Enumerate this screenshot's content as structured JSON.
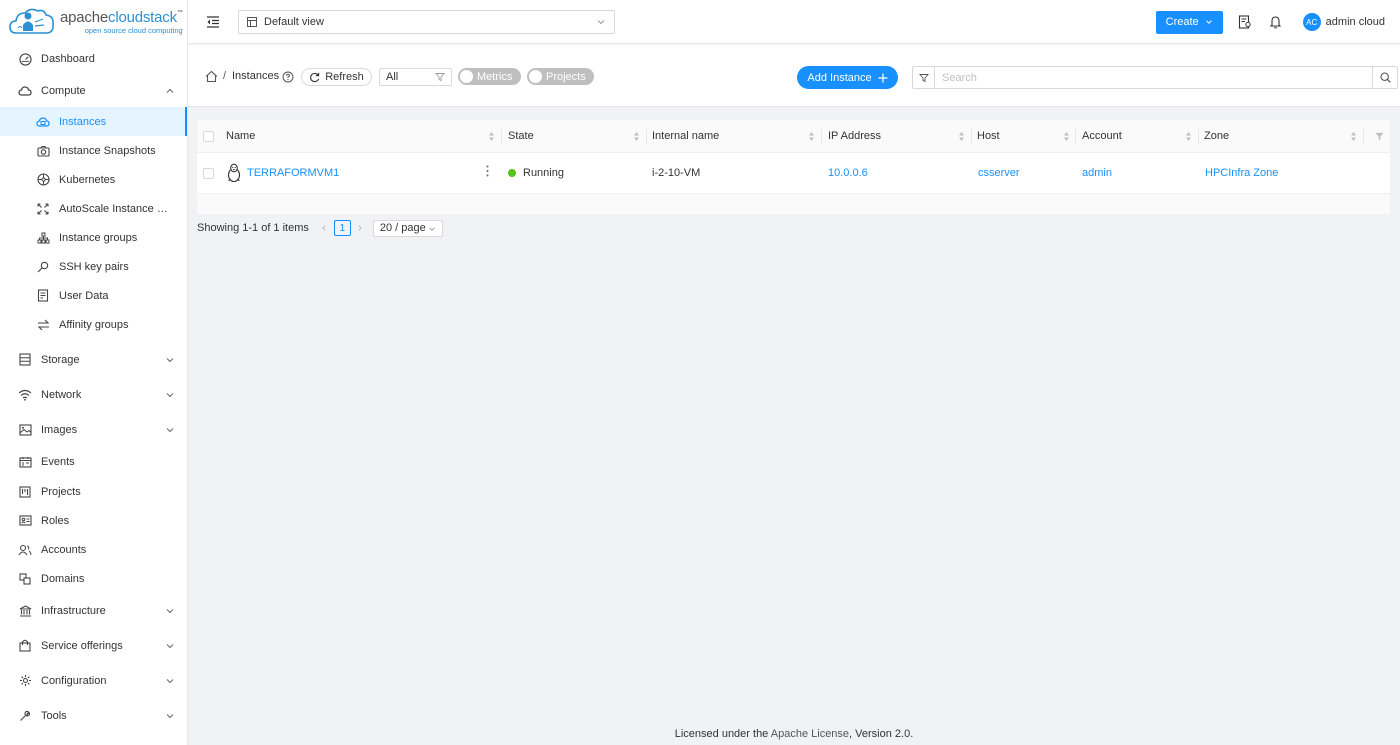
{
  "logo": {
    "brand_prefix": "apache",
    "brand_name": "cloudstack",
    "trademark": "™",
    "tagline": "open source cloud computing"
  },
  "sidebar": {
    "items": [
      {
        "label": "Dashboard",
        "icon": "dashboard-icon"
      },
      {
        "label": "Compute",
        "icon": "cloud-icon",
        "expanded": true
      },
      {
        "label": "Instances",
        "icon": "instances-icon",
        "active": true
      },
      {
        "label": "Instance Snapshots",
        "icon": "camera-icon"
      },
      {
        "label": "Kubernetes",
        "icon": "kubernetes-icon"
      },
      {
        "label": "AutoScale Instance Groups",
        "icon": "autoscale-icon"
      },
      {
        "label": "Instance groups",
        "icon": "cluster-icon"
      },
      {
        "label": "SSH key pairs",
        "icon": "key-icon"
      },
      {
        "label": "User Data",
        "icon": "user-data-icon"
      },
      {
        "label": "Affinity groups",
        "icon": "swap-icon"
      },
      {
        "label": "Storage",
        "icon": "database-icon"
      },
      {
        "label": "Network",
        "icon": "wifi-icon"
      },
      {
        "label": "Images",
        "icon": "picture-icon"
      },
      {
        "label": "Events",
        "icon": "schedule-icon"
      },
      {
        "label": "Projects",
        "icon": "project-icon"
      },
      {
        "label": "Roles",
        "icon": "idcard-icon"
      },
      {
        "label": "Accounts",
        "icon": "team-icon"
      },
      {
        "label": "Domains",
        "icon": "block-icon"
      },
      {
        "label": "Infrastructure",
        "icon": "bank-icon"
      },
      {
        "label": "Service offerings",
        "icon": "shopping-icon"
      },
      {
        "label": "Configuration",
        "icon": "setting-icon"
      },
      {
        "label": "Tools",
        "icon": "tool-icon"
      }
    ]
  },
  "header": {
    "view_select": "Default view",
    "create_label": "Create",
    "avatar_initials": "AC",
    "user_name": "admin cloud"
  },
  "toolbar": {
    "breadcrumb": "Instances",
    "breadcrumb_separator": "/",
    "refresh_label": "Refresh",
    "filter_value": "All",
    "metrics_label": "Metrics",
    "projects_label": "Projects",
    "add_label": "Add Instance",
    "search_placeholder": "Search"
  },
  "table": {
    "columns": [
      "Name",
      "State",
      "Internal name",
      "IP Address",
      "Host",
      "Account",
      "Zone"
    ],
    "rows": [
      {
        "name": "TERRAFORMVM1",
        "state": "Running",
        "internal_name": "i-2-10-VM",
        "ip": "10.0.0.6",
        "host": "csserver",
        "account": "admin",
        "zone": "HPCInfra Zone"
      }
    ]
  },
  "pagination": {
    "summary": "Showing 1-1 of 1 items",
    "current_page": "1",
    "page_size": "20 / page"
  },
  "footer": {
    "prefix": "Licensed under the ",
    "link": "Apache License",
    "suffix": ", Version 2.0."
  },
  "colors": {
    "accent": "#1890ff",
    "running": "#52c41a",
    "active_bg": "#e6f4ff"
  }
}
